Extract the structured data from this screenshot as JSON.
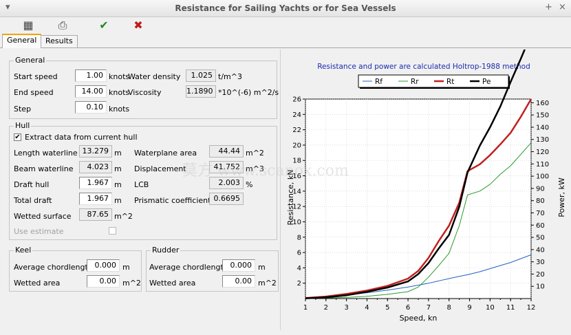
{
  "window": {
    "title": "Resistance for Sailing Yachts or for Sea Vessels",
    "pin": "+",
    "close": "×",
    "menu": "▾"
  },
  "toolbar": {
    "calc_icon": "▦",
    "print_icon": "⎙",
    "ok_icon": "✔",
    "cancel_icon": "✖"
  },
  "tabs": [
    "General",
    "Results"
  ],
  "general": {
    "legend": "General",
    "start_speed": {
      "label": "Start speed",
      "value": "1.00",
      "unit": "knots"
    },
    "end_speed": {
      "label": "End speed",
      "value": "14.00",
      "unit": "knots"
    },
    "step": {
      "label": "Step",
      "value": "0.10",
      "unit": "knots"
    },
    "water_density": {
      "label": "Water density",
      "value": "1.025",
      "unit": "t/m^3"
    },
    "viscosity": {
      "label": "Viscosity",
      "value": "1.1890",
      "unit": "*10^(-6) m^2/s"
    }
  },
  "hull": {
    "legend": "Hull",
    "extract_label": "Extract data from current hull",
    "extract_checked": "✔",
    "length_wl": {
      "label": "Length waterline",
      "value": "13.279",
      "unit": "m"
    },
    "beam_wl": {
      "label": "Beam waterline",
      "value": "4.023",
      "unit": "m"
    },
    "draft_hull": {
      "label": "Draft hull",
      "value": "1.967",
      "unit": "m"
    },
    "total_draft": {
      "label": "Total draft",
      "value": "1.967",
      "unit": "m"
    },
    "wetted_surface": {
      "label": "Wetted surface",
      "value": "87.65",
      "unit": "m^2"
    },
    "use_estimate": "Use estimate",
    "waterplane_area": {
      "label": "Waterplane area",
      "value": "44.44",
      "unit": "m^2"
    },
    "displacement": {
      "label": "Displacement",
      "value": "41.752",
      "unit": "m^3"
    },
    "lcb": {
      "label": "LCB",
      "value": "2.003",
      "unit": "%"
    },
    "prismatic": {
      "label": "Prismatic coefficient",
      "value": "0.6695"
    }
  },
  "keel": {
    "legend": "Keel",
    "chord": {
      "label": "Average chordlength",
      "value": "0.000",
      "unit": "m"
    },
    "wetted": {
      "label": "Wetted area",
      "value": "0.00",
      "unit": "m^2"
    }
  },
  "rudder": {
    "legend": "Rudder",
    "chord": {
      "label": "Average chordlength",
      "value": "0.000",
      "unit": "m"
    },
    "wetted": {
      "label": "Wetted area",
      "value": "0.00",
      "unit": "m^2"
    }
  },
  "watermark": "莫方 www.scanox.com",
  "chart_data": {
    "type": "line",
    "title": "Resistance and power are calculated Holtrop-1988 method",
    "xlabel": "Speed, kn",
    "ylabel": "Resistance, kN",
    "y2label": "Power, kW",
    "xlim": [
      1,
      12
    ],
    "ylim": [
      0,
      26
    ],
    "y2lim": [
      0,
      163
    ],
    "xticks": [
      "1",
      "2",
      "3",
      "4",
      "5",
      "6",
      "7",
      "8",
      "9",
      "10",
      "11",
      "12"
    ],
    "yticks": [
      "2",
      "4",
      "6",
      "8",
      "10",
      "12",
      "14",
      "16",
      "18",
      "20",
      "22",
      "24",
      "26"
    ],
    "y2ticks": [
      "10",
      "20",
      "30",
      "40",
      "50",
      "60",
      "70",
      "80",
      "90",
      "100",
      "110",
      "120",
      "130",
      "140",
      "150",
      "160"
    ],
    "legend_position": "top",
    "x": [
      1,
      2,
      3,
      4,
      5,
      6,
      6.5,
      7,
      7.5,
      8,
      8.5,
      8.9,
      9.5,
      10,
      10.5,
      11,
      11.5,
      12
    ],
    "series": [
      {
        "name": "Rf",
        "color": "#1f5fbf",
        "axis": "left",
        "width": 1,
        "values": [
          0.05,
          0.2,
          0.45,
          0.75,
          1.1,
          1.5,
          1.75,
          2.0,
          2.3,
          2.6,
          2.9,
          3.1,
          3.5,
          3.9,
          4.3,
          4.7,
          5.2,
          5.7
        ]
      },
      {
        "name": "Rr",
        "color": "#2a9a2a",
        "axis": "left",
        "width": 1,
        "values": [
          0.02,
          0.06,
          0.15,
          0.3,
          0.55,
          0.9,
          1.5,
          2.8,
          4.3,
          5.9,
          9.5,
          13.5,
          14.0,
          14.9,
          16.2,
          17.3,
          18.8,
          20.3
        ]
      },
      {
        "name": "Rt",
        "color": "#c0201f",
        "axis": "left",
        "width": 2.5,
        "values": [
          0.07,
          0.26,
          0.6,
          1.05,
          1.65,
          2.6,
          3.6,
          5.3,
          7.5,
          9.5,
          12.5,
          16.6,
          17.5,
          18.7,
          20.1,
          21.6,
          23.7,
          26.0
        ]
      },
      {
        "name": "Pe",
        "color": "#000000",
        "axis": "right",
        "width": 2.5,
        "values": [
          0.2,
          1,
          2.7,
          5.5,
          9,
          14,
          20,
          29,
          41,
          52,
          75,
          103,
          125,
          140,
          157,
          177,
          196,
          216
        ]
      }
    ]
  }
}
